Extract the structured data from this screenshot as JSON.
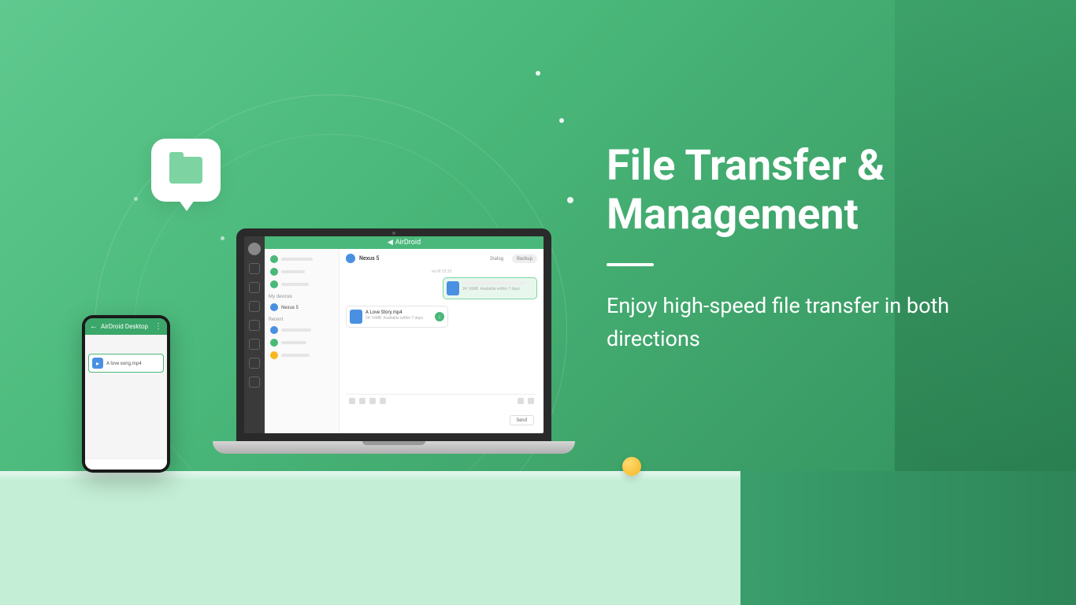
{
  "hero": {
    "title": "File Transfer & Management",
    "subtitle": "Enjoy high-speed file transfer in both directions"
  },
  "phone": {
    "header_title": "AirDroid Desktop",
    "file_name": "A love song.mp4"
  },
  "laptop": {
    "app_name": "AirDroid",
    "chat_device": "Nexus 5",
    "tabs": {
      "dialog": "Dialog",
      "backup": "Backup"
    },
    "list": {
      "my_devices_label": "My devices",
      "device_name": "Nexus 5",
      "recent_label": "Recent"
    },
    "timestamp": "via W 33.33",
    "msg_out": {
      "size": "24.16MB",
      "availability": "Available within 7 days"
    },
    "msg_in": {
      "title": "A Love Story.mp4",
      "size": "24.16MB",
      "availability": "Available within 7 days"
    },
    "send_label": "Send"
  }
}
